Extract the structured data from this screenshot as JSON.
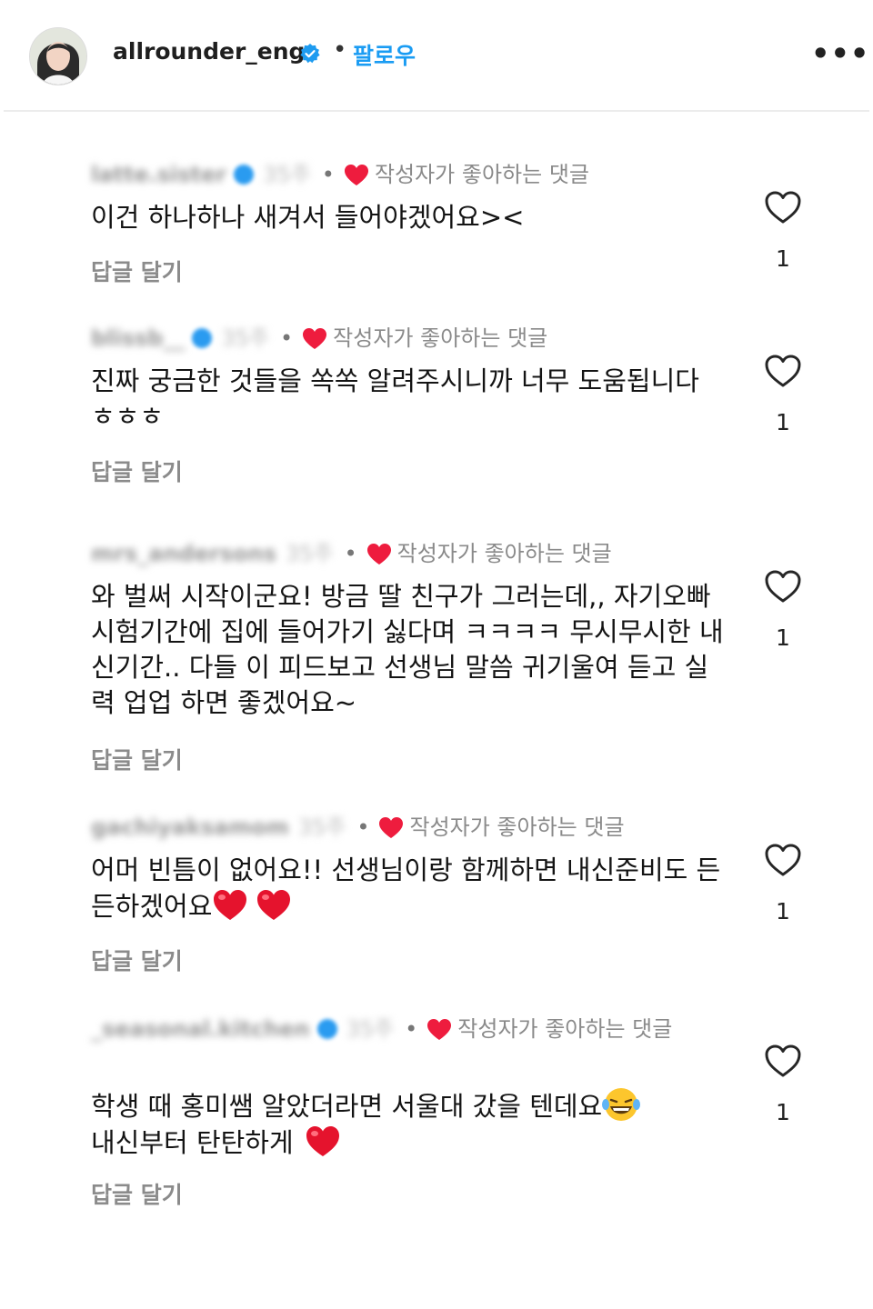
{
  "header": {
    "username": "allrounder_eng",
    "separator": "•",
    "follow_label": "팔로우",
    "more_label": "•••"
  },
  "colors": {
    "accent": "#1a9cf3",
    "heart_red": "#ee1c3e",
    "muted": "#8a8a8a"
  },
  "icons": [
    "avatar-photo",
    "verified-badge-icon",
    "heart-icon",
    "more-options-icon",
    "red-heart-emoji",
    "laughing-crying-emoji"
  ],
  "comments": [
    {
      "username": "latte.sister",
      "time": "35주",
      "dot": "•",
      "liked_label": "작성자가 좋아하는 댓글",
      "text": "이건 하나하나 새겨서 들어야겠어요><",
      "text2": "",
      "reply": "답글 달기",
      "likes": "1"
    },
    {
      "username": "blissb__",
      "time": "35주",
      "dot": "•",
      "liked_label": "작성자가 좋아하는 댓글",
      "text": "진짜 궁금한 것들을 쏙쏙 알려주시니까 너무 도움됩니다 ㅎㅎㅎ",
      "text2": "",
      "reply": "답글 달기",
      "likes": "1"
    },
    {
      "username": "mrs_andersons",
      "time": "35주",
      "dot": "•",
      "liked_label": "작성자가 좋아하는 댓글",
      "text": "와 벌써 시작이군요! 방금 딸 친구가 그러는데,, 자기오빠 시험기간에 집에 들어가기 싫다며 ㅋㅋㅋㅋ 무시무시한 내신기간.. 다들 이 피드보고 선생님 말씀 귀기울여 듣고 실력 업업 하면 좋겠어요~",
      "text2": "",
      "reply": "답글 달기",
      "likes": "1"
    },
    {
      "username": "gachiyaksamom",
      "time": "35주",
      "dot": "•",
      "liked_label": "작성자가 좋아하는 댓글",
      "text": "어머 빈틈이 없어요!! 선생님이랑 함께하면 내신준비도 든든하겠어요",
      "text2": "",
      "reply": "답글 달기",
      "likes": "1"
    },
    {
      "username": "_seasonal.kitchen",
      "time": "35주",
      "dot": "•",
      "liked_label": "작성자가 좋아하는 댓글",
      "text": "학생 때 홍미쌤 알았더라면 서울대 갔을 텐데요",
      "text2": "내신부터 탄탄하게",
      "reply": "답글 달기",
      "likes": "1"
    }
  ]
}
